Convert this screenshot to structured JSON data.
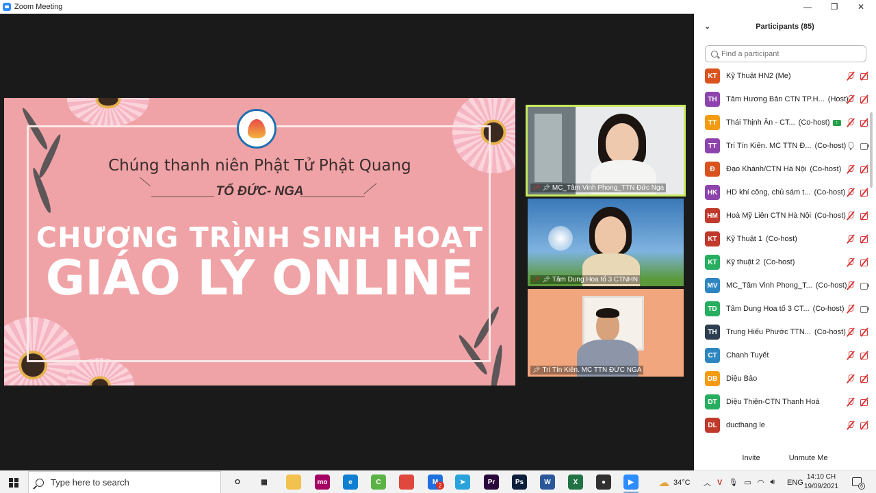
{
  "window": {
    "title": "Zoom Meeting",
    "controls": {
      "minimize": "—",
      "maximize": "❐",
      "close": "✕"
    }
  },
  "slide": {
    "org": "Chúng thanh niên Phật Tử Phật Quang",
    "group": "TỔ ĐỨC- NGA",
    "heading1": "CHƯƠNG TRÌNH SINH HOẠT",
    "heading2": "GIÁO LÝ ONLINE"
  },
  "videos": [
    {
      "name": "MC_Tâm Vinh Phong_TTN Đức Nga",
      "muted": true,
      "active": true
    },
    {
      "name": "Tâm Dung Hoa tổ 3 CTNHN",
      "muted": true,
      "active": false
    },
    {
      "name": "Trí Tín Kiên. MC  TTN ĐỨC NGA",
      "muted": false,
      "active": false
    }
  ],
  "participants_panel": {
    "title": "Participants (85)",
    "search_placeholder": "Find a participant",
    "items": [
      {
        "initials": "KT",
        "color": "#d9531e",
        "name": "Kỹ Thuật HN2 (Me)",
        "role": "",
        "mic": "muted",
        "video": "off",
        "share": false
      },
      {
        "initials": "TH",
        "color": "#8e44ad",
        "name": "Tâm Hương Bản CTN TP.H...",
        "role": "(Host)",
        "mic": "muted",
        "video": "off",
        "share": false
      },
      {
        "initials": "TT",
        "color": "#f39c12",
        "name": "Thái Thịnh Ân - CT...",
        "role": "(Co-host)",
        "mic": "muted",
        "video": "off",
        "share": true
      },
      {
        "initials": "TT",
        "color": "#8e44ad",
        "name": "Trí Tín Kiên. MC  TTN Đ...",
        "role": "(Co-host)",
        "mic": "on",
        "video": "on",
        "share": false
      },
      {
        "initials": "Đ",
        "color": "#d9531e",
        "name": "Đạo Khánh/CTN Hà Nội",
        "role": "(Co-host)",
        "mic": "muted",
        "video": "off",
        "share": false
      },
      {
        "initials": "HK",
        "color": "#8e44ad",
        "name": "HD khí công, chủ sám t...",
        "role": "(Co-host)",
        "mic": "muted",
        "video": "off",
        "share": false
      },
      {
        "initials": "HM",
        "color": "#c0392b",
        "name": "Hoà Mỹ Liên CTN Hà Nội",
        "role": "(Co-host)",
        "mic": "muted",
        "video": "off",
        "share": false
      },
      {
        "initials": "KT",
        "color": "#c0392b",
        "name": "Kỹ Thuật 1",
        "role": "(Co-host)",
        "mic": "muted",
        "video": "off",
        "share": false
      },
      {
        "initials": "KT",
        "color": "#27ae60",
        "name": "Kỹ thuật 2",
        "role": "(Co-host)",
        "mic": "muted",
        "video": "off",
        "share": false
      },
      {
        "initials": "MV",
        "color": "#2e86c1",
        "name": "MC_Tâm Vinh Phong_T...",
        "role": "(Co-host)",
        "mic": "muted",
        "video": "on",
        "share": false
      },
      {
        "initials": "TD",
        "color": "#27ae60",
        "name": "Tâm Dung Hoa tổ 3 CT...",
        "role": "(Co-host)",
        "mic": "muted",
        "video": "on",
        "share": false
      },
      {
        "initials": "TH",
        "color": "#2c3e50",
        "name": "Trung Hiếu Phước TTN...",
        "role": "(Co-host)",
        "mic": "muted",
        "video": "off",
        "share": false
      },
      {
        "initials": "CT",
        "color": "#2e86c1",
        "name": "Chanh Tuyết",
        "role": "",
        "mic": "muted",
        "video": "off",
        "share": false
      },
      {
        "initials": "DB",
        "color": "#f39c12",
        "name": "Diệu Bảo",
        "role": "",
        "mic": "muted",
        "video": "off",
        "share": false
      },
      {
        "initials": "DT",
        "color": "#27ae60",
        "name": "Diệu Thiện-CTN Thanh Hoá",
        "role": "",
        "mic": "muted",
        "video": "off",
        "share": false
      },
      {
        "initials": "DL",
        "color": "#c0392b",
        "name": "ducthang le",
        "role": "",
        "mic": "muted",
        "video": "off",
        "share": false
      }
    ],
    "invite_label": "Invite",
    "unmute_label": "Unmute Me"
  },
  "taskbar": {
    "search_placeholder": "Type here to search",
    "weather": "34°C",
    "language": "ENG",
    "time": "14:10 CH",
    "date": "19/09/2021",
    "notification_count": "6",
    "telegram_badge": "2",
    "apps": [
      {
        "id": "task-view",
        "label": "O",
        "color": "#f2f2f2"
      },
      {
        "id": "multitask",
        "label": "▦",
        "color": "#f2f2f2"
      },
      {
        "id": "file-explorer",
        "label": "",
        "color": "#f2c14e"
      },
      {
        "id": "momo",
        "label": "mo",
        "color": "#a50064"
      },
      {
        "id": "edge",
        "label": "e",
        "color": "#0f7fd1"
      },
      {
        "id": "coccoc",
        "label": "C",
        "color": "#5bb346"
      },
      {
        "id": "chrome",
        "label": "",
        "color": "#e0483e"
      },
      {
        "id": "messenger",
        "label": "M",
        "color": "#1f6fe0"
      },
      {
        "id": "telegram",
        "label": "➤",
        "color": "#2aa3dd"
      },
      {
        "id": "premiere",
        "label": "Pr",
        "color": "#2a0a3c"
      },
      {
        "id": "photoshop",
        "label": "Ps",
        "color": "#0b1f3a"
      },
      {
        "id": "word",
        "label": "W",
        "color": "#2b579a"
      },
      {
        "id": "excel",
        "label": "X",
        "color": "#217346"
      },
      {
        "id": "obs",
        "label": "●",
        "color": "#303030"
      },
      {
        "id": "zoom",
        "label": "▶",
        "color": "#2d8cff"
      }
    ]
  }
}
